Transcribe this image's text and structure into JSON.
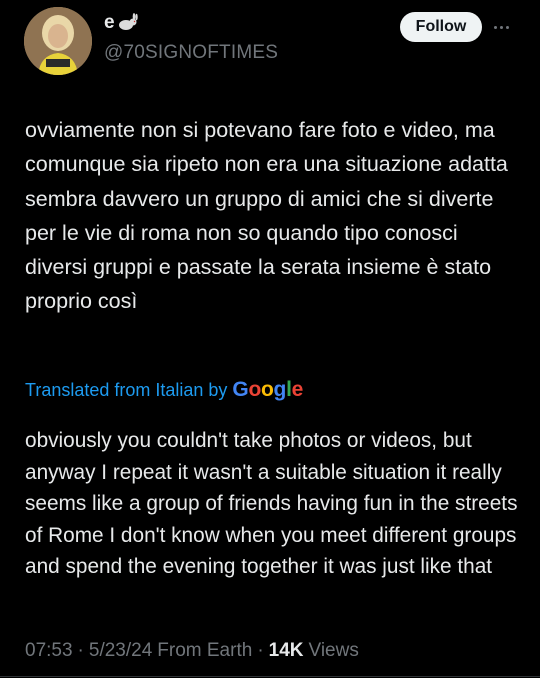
{
  "author": {
    "display_name": "e",
    "handle": "@70SIGNOFTIMES",
    "avatar_icon": "user-avatar",
    "name_emoji_icon": "rabbit-icon"
  },
  "actions": {
    "follow_label": "Follow",
    "more_icon": "more-horizontal-icon"
  },
  "post": {
    "original_text": "ovviamente non si potevano fare foto e video, ma comunque sia ripeto non era una situazione adatta sembra davvero un gruppo di amici che si diverte per le vie di roma non so quando tipo conosci diversi gruppi e passate la serata insieme è stato proprio così",
    "translation_label": "Translated from Italian by",
    "translation_provider": "Google",
    "translated_text": "obviously you couldn't take photos or videos, but anyway I repeat it wasn't a suitable situation it really seems like a group of friends having fun in the streets of Rome I don't know when you meet different groups and spend the evening together it was just like that"
  },
  "meta": {
    "time": "07:53",
    "separator": "·",
    "date": "5/23/24",
    "location": "From Earth",
    "views_count": "14K",
    "views_label": "Views"
  },
  "colors": {
    "background": "#000000",
    "text": "#e7e9ea",
    "secondary": "#71767b",
    "link": "#1d9bf0"
  }
}
